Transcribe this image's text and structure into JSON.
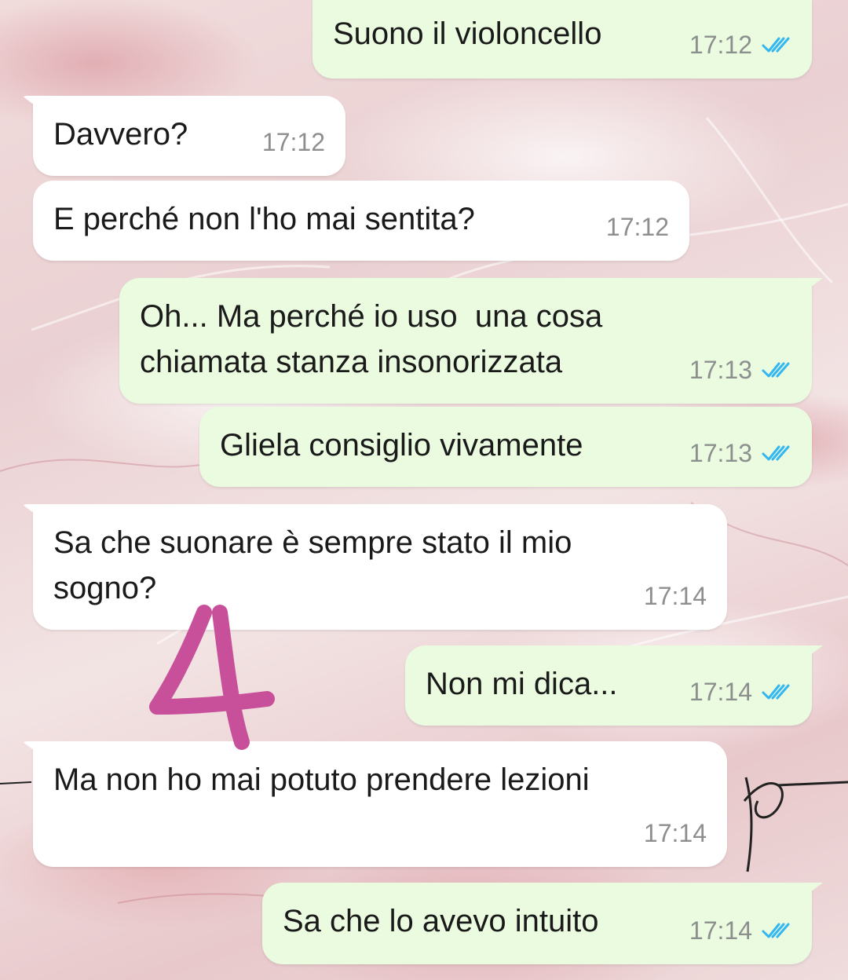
{
  "messages": [
    {
      "text": "Suono il violoncello",
      "time": "17:12",
      "dir": "out",
      "status": "read"
    },
    {
      "text": "Davvero?",
      "time": "17:12",
      "dir": "in"
    },
    {
      "text": "E perché non l'ho mai sentita?",
      "time": "17:12",
      "dir": "in"
    },
    {
      "text": "Oh... Ma perché io uso  una cosa\nchiamata stanza insonorizzata",
      "time": "17:13",
      "dir": "out",
      "status": "read"
    },
    {
      "text": "Gliela consiglio vivamente",
      "time": "17:13",
      "dir": "out",
      "status": "read"
    },
    {
      "text": "Sa che suonare è sempre stato il mio\nsogno?",
      "time": "17:14",
      "dir": "in"
    },
    {
      "text": "Non mi dica...",
      "time": "17:14",
      "dir": "out",
      "status": "read"
    },
    {
      "text": "Ma non ho mai potuto prendere lezioni",
      "time": "17:14",
      "dir": "in"
    },
    {
      "text": "Sa che lo avevo intuito",
      "time": "17:14",
      "dir": "out",
      "status": "read"
    }
  ],
  "overlay": {
    "number": "4",
    "color": "#c8509a"
  },
  "colors": {
    "incoming_bubble": "#ffffff",
    "outgoing_bubble": "#eafbe0",
    "read_ticks": "#34b7f1"
  }
}
